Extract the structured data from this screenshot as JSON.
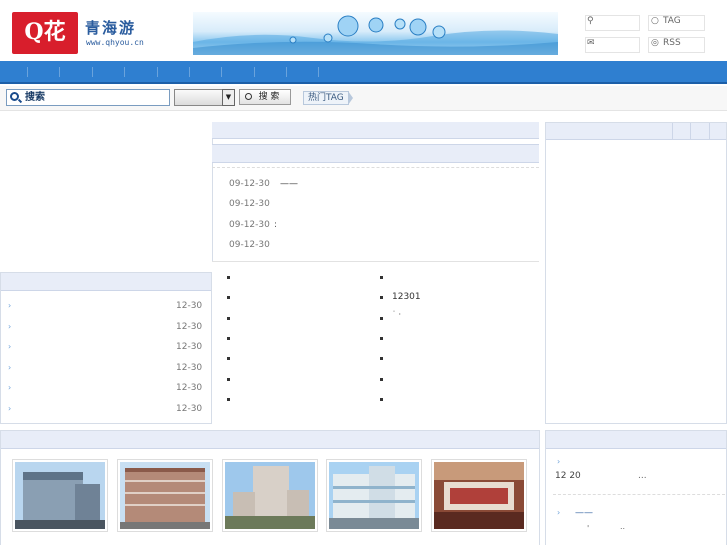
{
  "header": {
    "logo_glyph": "Q花",
    "site_name": "青海游",
    "site_url": "www.qhyou.cn",
    "top_links": [
      "TAG",
      "RSS"
    ]
  },
  "search": {
    "input_value": "搜索",
    "button_label": "搜 索",
    "hot_tag_label": "热门TAG"
  },
  "center": {
    "news": [
      {
        "date": "09-12-30",
        "text": "——"
      },
      {
        "date": "09-12-30",
        "text": ""
      },
      {
        "date": "09-12-30",
        "text": ":"
      },
      {
        "date": "09-12-30",
        "text": ""
      }
    ],
    "list_left": [
      "",
      "",
      "",
      "",
      "",
      "",
      ""
    ],
    "list_right": [
      "",
      "12301",
      "˙ ·",
      "",
      "",
      "",
      ""
    ]
  },
  "left": {
    "dates": [
      "12-30",
      "12-30",
      "12-30",
      "12-30",
      "12-30",
      "12-30"
    ]
  },
  "right_bottom": {
    "line1": "12 20",
    "line1_tail": "...",
    "line2": "——",
    "line3": "'",
    "line3_tail": ".."
  },
  "colors": {
    "nav": "#2f7fd0",
    "panel_header": "#e8edf8",
    "logo": "#d81e2c"
  }
}
